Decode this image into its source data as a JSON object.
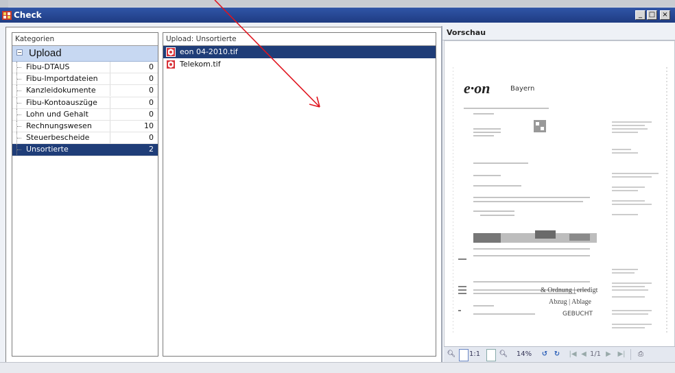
{
  "window": {
    "title": "Check",
    "minimize": "_",
    "maximize": "□",
    "close": "×"
  },
  "categories_pane": {
    "header": "Kategorien",
    "group_label": "Upload",
    "items": [
      {
        "name": "Fibu-DTAUS",
        "count": "0"
      },
      {
        "name": "Fibu-Importdateien",
        "count": "0"
      },
      {
        "name": "Kanzleidokumente",
        "count": "0"
      },
      {
        "name": "Fibu-Kontoauszüge",
        "count": "0"
      },
      {
        "name": "Lohn und Gehalt",
        "count": "0"
      },
      {
        "name": "Rechnungswesen",
        "count": "10"
      },
      {
        "name": "Steuerbescheide",
        "count": "0"
      },
      {
        "name": "Unsortierte",
        "count": "2"
      }
    ]
  },
  "files_pane": {
    "header": "Upload: Unsortierte",
    "files": [
      {
        "name": "eon 04-2010.tif"
      },
      {
        "name": "Telekom.tif"
      }
    ]
  },
  "preview": {
    "header": "Vorschau",
    "doc_logo": "e·on",
    "doc_logo_sub": "Bayern",
    "zoom": "14%",
    "page_one_to_one": "1:1",
    "page_indicator": "1/1",
    "doc_handwriting_1": "& Ordnung | erledigt",
    "doc_handwriting_2": "Abzug | Ablage",
    "doc_handwriting_3": "GEBUCHT"
  },
  "colors": {
    "titlebar": "#1f3c82",
    "selection": "#1f3d78",
    "arrow": "#e0141e"
  }
}
